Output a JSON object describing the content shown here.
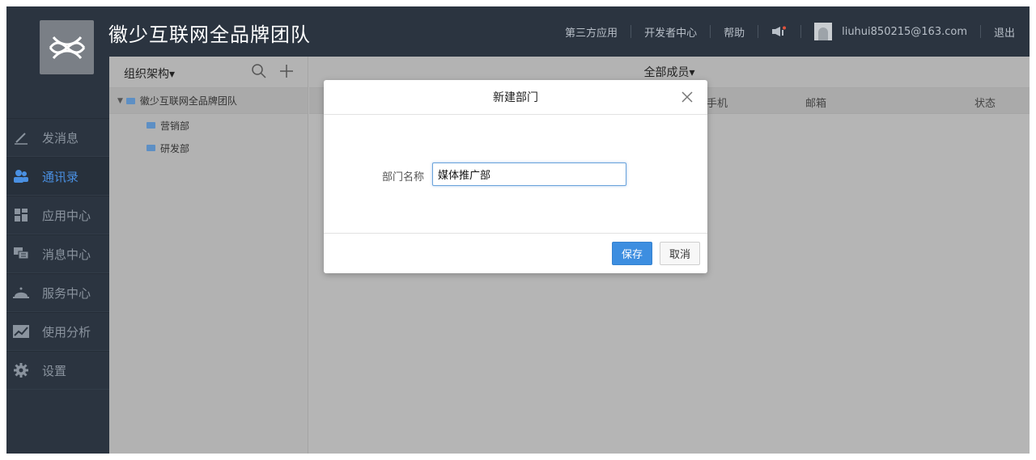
{
  "header": {
    "org_title": "徽少互联网全品牌团队",
    "links": {
      "third_party": "第三方应用",
      "developer": "开发者中心",
      "help": "帮助",
      "user_email": "liuhui850215@163.com",
      "logout": "退出"
    }
  },
  "sidebar": {
    "items": [
      {
        "label": "发消息",
        "icon": "pencil-icon"
      },
      {
        "label": "通讯录",
        "icon": "contacts-icon",
        "active": true
      },
      {
        "label": "应用中心",
        "icon": "apps-icon"
      },
      {
        "label": "消息中心",
        "icon": "messages-icon"
      },
      {
        "label": "服务中心",
        "icon": "service-bell-icon"
      },
      {
        "label": "使用分析",
        "icon": "analytics-chart-icon"
      },
      {
        "label": "设置",
        "icon": "gear-icon"
      }
    ]
  },
  "org_panel": {
    "header_label": "组织架构▾",
    "root": "徽少互联网全品牌团队",
    "departments": [
      "营销部",
      "研发部"
    ]
  },
  "members_panel": {
    "header_label": "全部成员▾",
    "columns": {
      "phone": "手机",
      "email": "邮箱",
      "status": "状态"
    }
  },
  "modal": {
    "title": "新建部门",
    "field_label": "部门名称",
    "field_value": "媒体推广部",
    "save_label": "保存",
    "cancel_label": "取消"
  },
  "colors": {
    "topbar": "#2b3440",
    "active_nav": "#4a90e2",
    "save_button": "#3d8ee0",
    "overlay": "#b5b5b5"
  }
}
